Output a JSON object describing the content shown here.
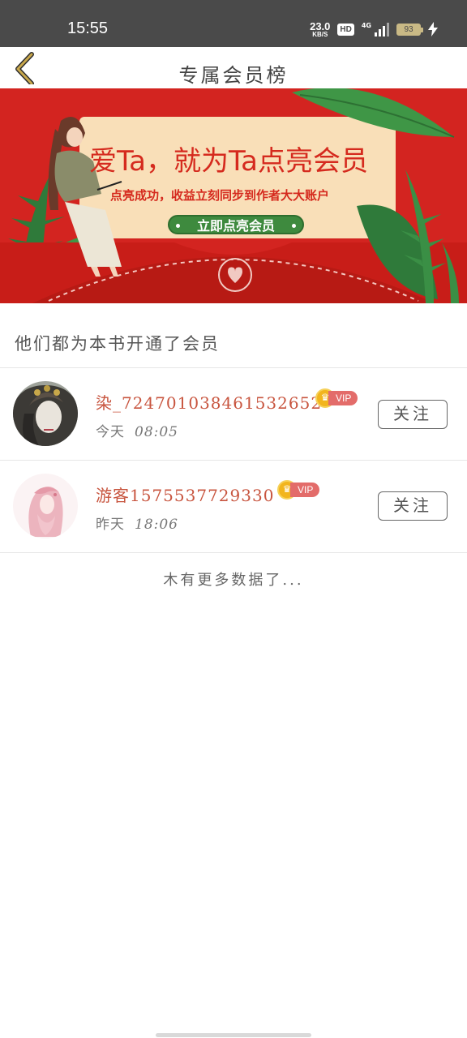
{
  "status_bar": {
    "time": "15:55",
    "speed_value": "23.0",
    "speed_unit": "KB/S",
    "hd": "HD",
    "network": "4G",
    "battery": "93"
  },
  "header": {
    "title": "专属会员榜",
    "back_icon": "chevron-left-icon"
  },
  "banner": {
    "title": "爱Ta，就为Ta点亮会员",
    "subtitle": "点亮成功，收益立刻同步到作者大大账户",
    "cta": "立即点亮会员"
  },
  "section": {
    "title": "他们都为本书开通了会员"
  },
  "members": [
    {
      "name": "染_724701038461532652",
      "badge": "VIP",
      "day": "今天",
      "time": "08:05",
      "follow": "关注"
    },
    {
      "name": "游客1575537729330",
      "badge": "VIP",
      "day": "昨天",
      "time": "18:06",
      "follow": "关注"
    }
  ],
  "footer": {
    "no_more": "木有更多数据了..."
  },
  "colors": {
    "accent_name": "#c8553f",
    "banner_red": "#d32420",
    "vip_gold": "#f2b51d",
    "vip_tag": "#e36c6a",
    "back_gold": "#c9a84c"
  }
}
